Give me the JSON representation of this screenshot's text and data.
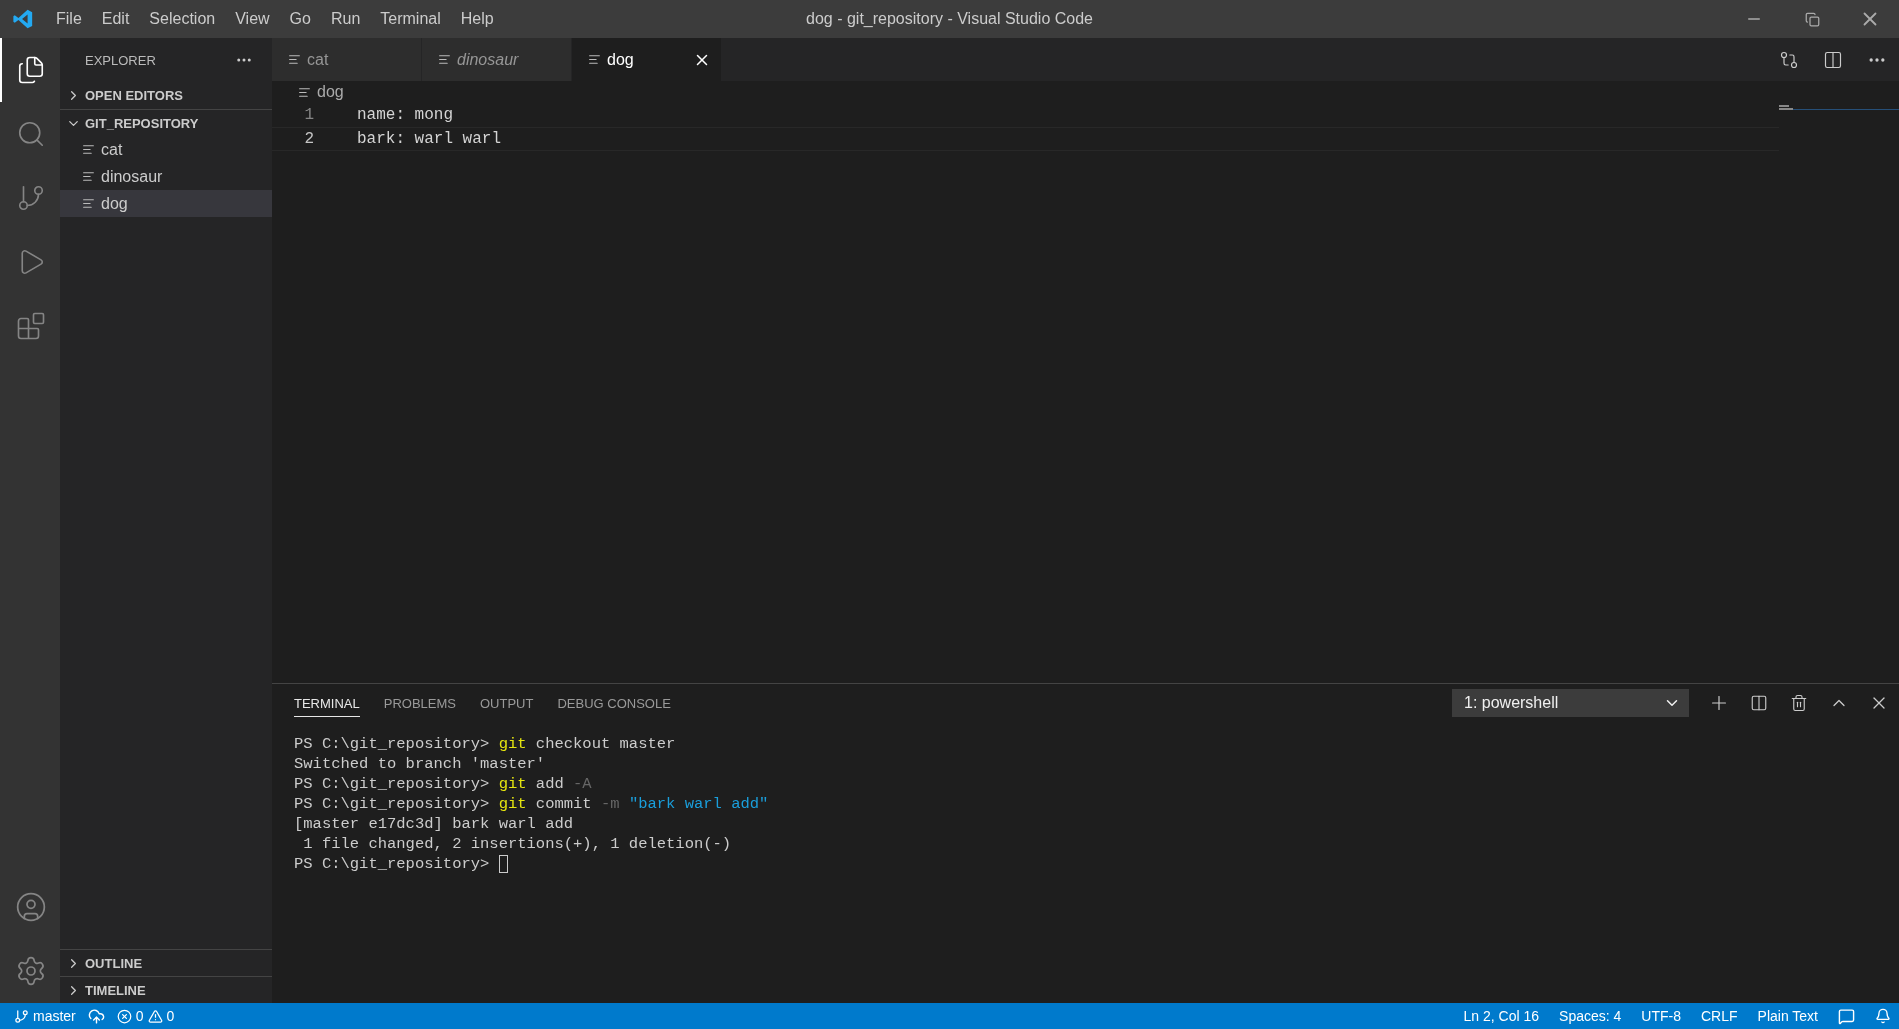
{
  "menu": [
    "File",
    "Edit",
    "Selection",
    "View",
    "Go",
    "Run",
    "Terminal",
    "Help"
  ],
  "window": {
    "title": "dog - git_repository - Visual Studio Code"
  },
  "activity_bar": [
    {
      "kind": "explorer",
      "selected": true
    },
    {
      "kind": "search",
      "selected": false
    },
    {
      "kind": "source-control",
      "selected": false
    },
    {
      "kind": "run",
      "selected": false
    },
    {
      "kind": "extensions",
      "selected": false
    }
  ],
  "sidebar": {
    "title": "EXPLORER",
    "sections": [
      {
        "label": "OPEN EDITORS",
        "expanded": false
      },
      {
        "label": "GIT_REPOSITORY",
        "expanded": true,
        "files": [
          {
            "name": "cat",
            "selected": false
          },
          {
            "name": "dinosaur",
            "selected": false
          },
          {
            "name": "dog",
            "selected": true
          }
        ]
      }
    ],
    "bottom_sections": [
      {
        "label": "OUTLINE",
        "expanded": false
      },
      {
        "label": "TIMELINE",
        "expanded": false
      }
    ]
  },
  "tabs": [
    {
      "label": "cat",
      "selected": false,
      "preview": false
    },
    {
      "label": "dinosaur",
      "selected": false,
      "preview": true
    },
    {
      "label": "dog",
      "selected": true,
      "preview": false
    }
  ],
  "breadcrumb": "dog",
  "editor": {
    "lines": [
      {
        "number": "1",
        "text": "name: mong"
      },
      {
        "number": "2",
        "text": "bark: warl warl"
      }
    ]
  },
  "panel": {
    "tabs": [
      {
        "label": "TERMINAL",
        "selected": true
      },
      {
        "label": "PROBLEMS",
        "selected": false
      },
      {
        "label": "OUTPUT",
        "selected": false
      },
      {
        "label": "DEBUG CONSOLE",
        "selected": false
      }
    ],
    "terminal_select": "1: powershell",
    "lines": [
      {
        "segments": [
          {
            "kind": "text",
            "text": "PS C:\\git_repository> "
          },
          {
            "kind": "command",
            "text": "git"
          },
          {
            "kind": "text",
            "text": " checkout master"
          }
        ]
      },
      {
        "segments": [
          {
            "kind": "text",
            "text": "Switched to branch 'master'"
          }
        ]
      },
      {
        "segments": [
          {
            "kind": "text",
            "text": "PS C:\\git_repository> "
          },
          {
            "kind": "command",
            "text": "git"
          },
          {
            "kind": "text",
            "text": " add "
          },
          {
            "kind": "flag",
            "text": "-A"
          }
        ]
      },
      {
        "segments": [
          {
            "kind": "text",
            "text": "PS C:\\git_repository> "
          },
          {
            "kind": "command",
            "text": "git"
          },
          {
            "kind": "text",
            "text": " commit "
          },
          {
            "kind": "flag",
            "text": "-m"
          },
          {
            "kind": "string",
            "text": " \"bark warl add\""
          }
        ]
      },
      {
        "segments": [
          {
            "kind": "text",
            "text": "[master e17dc3d] bark warl add"
          }
        ]
      },
      {
        "segments": [
          {
            "kind": "text",
            "text": " 1 file changed, 2 insertions(+), 1 deletion(-)"
          }
        ]
      },
      {
        "segments": [
          {
            "kind": "text",
            "text": "PS C:\\git_repository> "
          }
        ],
        "cursor": true
      }
    ]
  },
  "status_bar": {
    "branch": "master",
    "errors": "0",
    "warnings": "0",
    "right": [
      "Ln 2, Col 16",
      "Spaces: 4",
      "UTF-8",
      "CRLF",
      "Plain Text"
    ]
  }
}
